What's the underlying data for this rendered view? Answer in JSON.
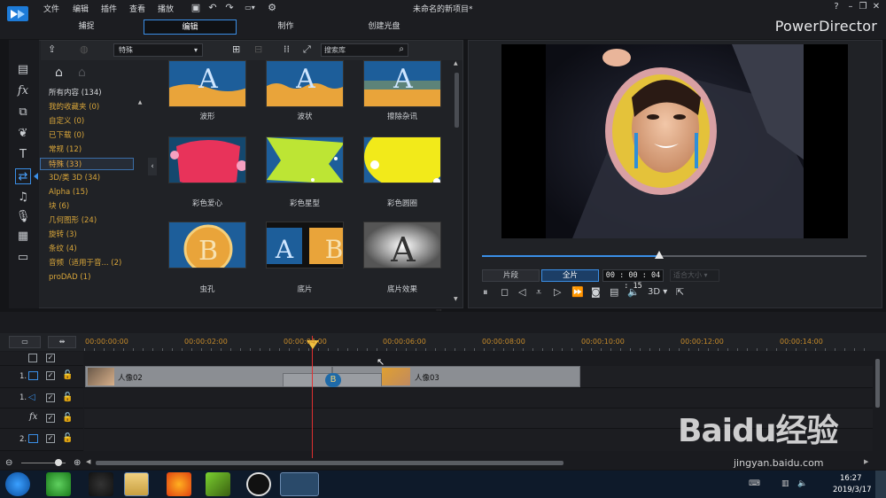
{
  "window": {
    "title": "未命名的新项目*",
    "brand": "PowerDirector",
    "controls": [
      "?",
      "–",
      "❐",
      "✕"
    ]
  },
  "menu": [
    "文件",
    "编辑",
    "插件",
    "查看",
    "播放"
  ],
  "mode_tabs": [
    {
      "label": "捕捉",
      "active": false
    },
    {
      "label": "编辑",
      "active": true
    },
    {
      "label": "制作",
      "active": false
    },
    {
      "label": "创建光盘",
      "active": false
    }
  ],
  "library": {
    "filter_select": "特殊",
    "search_placeholder": "搜索库",
    "categories": [
      {
        "label": "所有内容 (134)",
        "selected": false
      },
      {
        "label": "我的收藏夹 (0)",
        "selected": false
      },
      {
        "label": "自定义 (0)",
        "selected": false
      },
      {
        "label": "已下载 (0)",
        "selected": false
      },
      {
        "label": "常规 (12)",
        "selected": false
      },
      {
        "label": "特殊 (33)",
        "selected": true
      },
      {
        "label": "3D/类 3D (34)",
        "selected": false
      },
      {
        "label": "Alpha (15)",
        "selected": false
      },
      {
        "label": "块 (6)",
        "selected": false
      },
      {
        "label": "几何图形 (24)",
        "selected": false
      },
      {
        "label": "旋转 (3)",
        "selected": false
      },
      {
        "label": "条纹 (4)",
        "selected": false
      },
      {
        "label": "音频（适用于音...  (2)",
        "selected": false
      },
      {
        "label": "proDAD (1)",
        "selected": false
      }
    ],
    "transitions": [
      {
        "label": "波形"
      },
      {
        "label": "波状"
      },
      {
        "label": "擦除杂讯"
      },
      {
        "label": "彩色爱心"
      },
      {
        "label": "彩色星型"
      },
      {
        "label": "彩色圆圈"
      },
      {
        "label": "虫孔"
      },
      {
        "label": "底片"
      },
      {
        "label": "底片效果"
      }
    ]
  },
  "preview": {
    "buttons": {
      "clip": "片段",
      "movie": "全片"
    },
    "timecode": "00 : 00 : 04 : 15",
    "fit": "适合大小",
    "three_d": "3D",
    "progress": 0.46
  },
  "timeline": {
    "ruler": [
      "00:00:00:00",
      "00:00:02:00",
      "00:00:04:00",
      "00:00:06:00",
      "00:00:08:00",
      "00:00:10:00",
      "00:00:12:00",
      "00:00:14:00"
    ],
    "tracks": [
      {
        "label": "1."
      },
      {
        "label": "1."
      },
      {
        "label": "fx"
      },
      {
        "label": "2."
      }
    ],
    "clips": [
      "人像02",
      "人像03"
    ]
  },
  "taskbar": {
    "time": "16:27",
    "date": "2019/3/17"
  },
  "watermark": {
    "line1": "Baidu经验",
    "line2": "jingyan.baidu.com"
  },
  "colors": {
    "accent": "#3a8ee6",
    "category": "#d9a63a",
    "playhead": "#e03030",
    "ruler": "#c58a2a"
  }
}
